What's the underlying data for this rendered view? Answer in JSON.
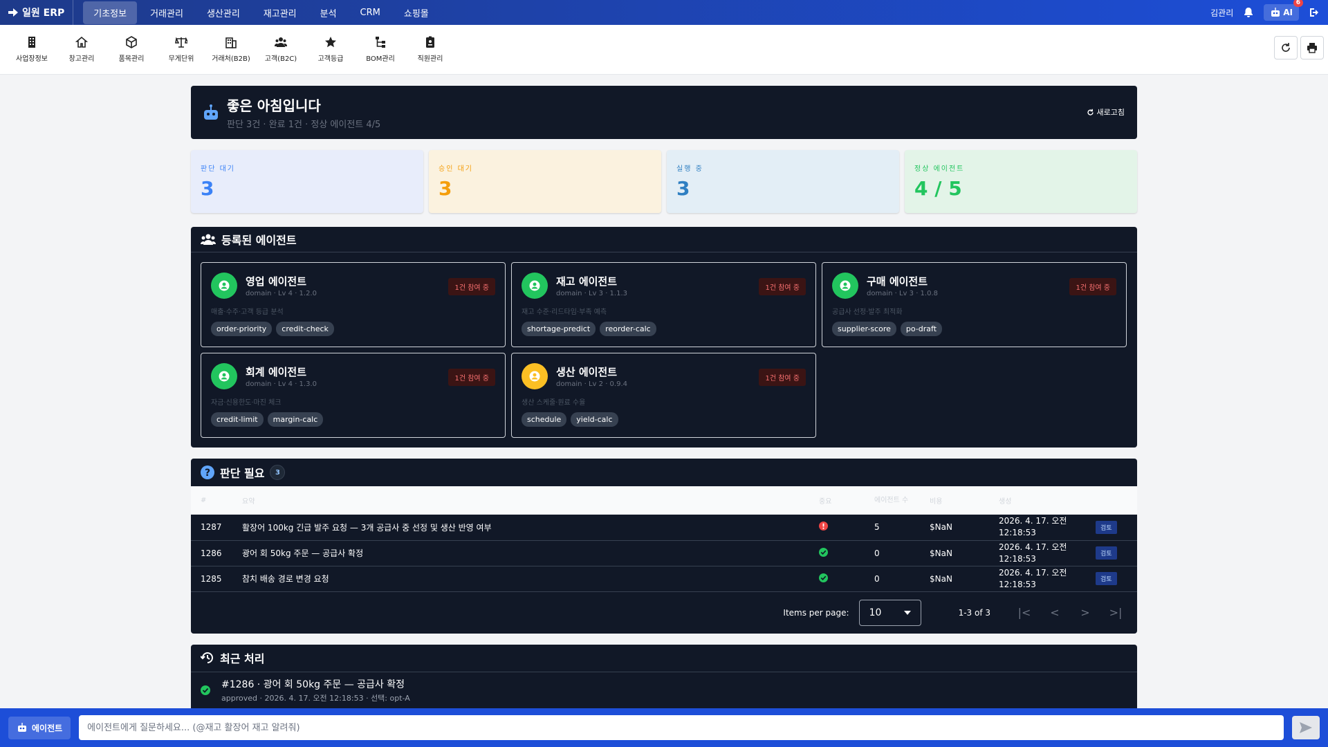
{
  "app": {
    "title": "일원 ERP"
  },
  "nav": {
    "items": [
      "기초정보",
      "거래관리",
      "생산관리",
      "재고관리",
      "분석",
      "CRM",
      "쇼핑몰"
    ],
    "active": "기초정보"
  },
  "user": {
    "name": "김관리",
    "ai_label": "AI",
    "ai_badge": "6"
  },
  "toolbar": {
    "items": [
      "사업장정보",
      "창고관리",
      "품목관리",
      "무게단위",
      "거래처(B2B)",
      "고객(B2C)",
      "고객등급",
      "BOM관리",
      "직원관리"
    ]
  },
  "greeting": {
    "title": "좋은 아침입니다",
    "subtitle": "판단 3건 · 완료 1건 · 정상 에이전트 4/5",
    "refresh_label": "새로고침"
  },
  "stats": [
    {
      "label": "판단 대기",
      "value": "3",
      "color": "#3b82f6",
      "bg": "#e8edfb"
    },
    {
      "label": "승인 대기",
      "value": "3",
      "color": "#f59e0b",
      "bg": "#fbf2df"
    },
    {
      "label": "실행 중",
      "value": "3",
      "color": "#2f7fc2",
      "bg": "#e3eef6"
    },
    {
      "label": "정상 에이전트",
      "value": "4 / 5",
      "color": "#22c55e",
      "bg": "#e3f4e8"
    }
  ],
  "agents_panel": {
    "title": "등록된 에이전트",
    "agents": [
      {
        "name": "영업 에이전트",
        "meta": "domain · Lv 4 · 1.2.0",
        "badge": "1건 참여 중",
        "desc": "매출·수주·고객 등급 분석",
        "tags": [
          "order-priority",
          "credit-check"
        ],
        "color": "#22c55e"
      },
      {
        "name": "재고 에이전트",
        "meta": "domain · Lv 3 · 1.1.3",
        "badge": "1건 참여 중",
        "desc": "재고 수준·리드타임·부족 예측",
        "tags": [
          "shortage-predict",
          "reorder-calc"
        ],
        "color": "#22c55e"
      },
      {
        "name": "구매 에이전트",
        "meta": "domain · Lv 3 · 1.0.8",
        "badge": "1건 참여 중",
        "desc": "공급사 선정·발주 최적화",
        "tags": [
          "supplier-score",
          "po-draft"
        ],
        "color": "#22c55e"
      },
      {
        "name": "회계 에이전트",
        "meta": "domain · Lv 4 · 1.3.0",
        "badge": "1건 참여 중",
        "desc": "자금·신용한도·마진 체크",
        "tags": [
          "credit-limit",
          "margin-calc"
        ],
        "color": "#22c55e"
      },
      {
        "name": "생산 에이전트",
        "meta": "domain · Lv 2 · 0.9.4",
        "badge": "1건 참여 중",
        "desc": "생산 스케줄·원료 수율",
        "tags": [
          "schedule",
          "yield-calc"
        ],
        "color": "#fbbf24"
      }
    ]
  },
  "decisions": {
    "title": "판단 필요",
    "count": "3",
    "columns": [
      "#",
      "요약",
      "중요",
      "에이전트 수",
      "비용",
      "생성",
      ""
    ],
    "rows": [
      {
        "id": "1287",
        "summary": "활장어 100kg 긴급 발주 요청 — 3개 공급사 중 선정 및 생산 반영 여부",
        "status": "urgent",
        "agents": "5",
        "cost": "$NaN",
        "created": "2026. 4. 17. 오전 12:18:53",
        "action": "검토"
      },
      {
        "id": "1286",
        "summary": "광어 회 50kg 주문 — 공급사 확정",
        "status": "ok",
        "agents": "0",
        "cost": "$NaN",
        "created": "2026. 4. 17. 오전 12:18:53",
        "action": "검토"
      },
      {
        "id": "1285",
        "summary": "참치 배송 경로 변경 요청",
        "status": "ok",
        "agents": "0",
        "cost": "$NaN",
        "created": "2026. 4. 17. 오전 12:18:53",
        "action": "검토"
      }
    ],
    "pagination": {
      "items_per_page_label": "Items per page:",
      "items_per_page": "10",
      "range": "1-3 of 3"
    }
  },
  "recent": {
    "title": "최근 처리",
    "items": [
      {
        "title": "#1286 · 광어 회 50kg 주문 — 공급사 확정",
        "detail": "approved · 2026. 4. 17. 오전 12:18:53 · 선택: opt-A"
      }
    ]
  },
  "chat": {
    "button_label": "에이전트",
    "placeholder": "에이전트에게 질문하세요... (@재고 활장어 재고 알려줘)"
  }
}
